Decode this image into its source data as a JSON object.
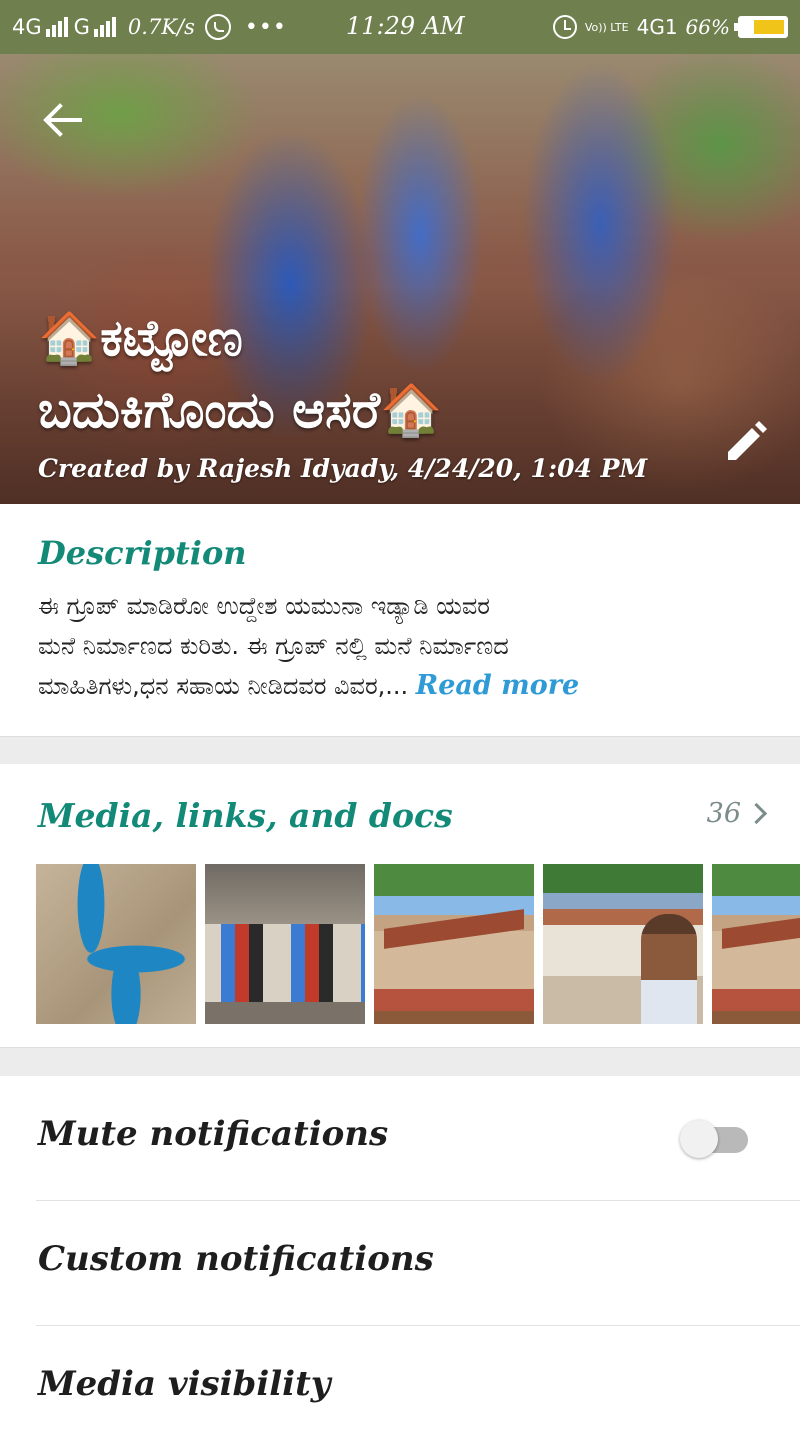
{
  "status_bar": {
    "network1": "4G",
    "network2": "G",
    "speed": "0.7K/s",
    "more": "•••",
    "time": "11:29 AM",
    "volte": "Vo)) LTE",
    "network3": "4G1",
    "battery_pct": "66%",
    "battery_level": 0.66,
    "icons": [
      "signal-bars-icon",
      "whatsapp-icon",
      "alarm-icon",
      "battery-icon"
    ]
  },
  "header": {
    "title_line1": "🏠ಕಟ್ಟೋಣ",
    "title_line2": "ಬದುಕಿಗೊಂದು ಆಸರೆ🏠",
    "created_by": "Created by Rajesh Idyady, 4/24/20, 1:04 PM",
    "back_icon": "back-arrow-icon",
    "edit_icon": "pencil-icon"
  },
  "description": {
    "heading": "Description",
    "text_line1": "ಈ ಗ್ರೂಪ್ ಮಾಡಿರೋ ಉದ್ದೇಶ ಯಮುನಾ ಇಡ್ಯಾಡಿ ಯವರ",
    "text_line2": "ಮನೆ ನಿರ್ಮಾಣದ ಕುರಿತು. ಈ ಗ್ರೂಪ್ ನಲ್ಲಿ ಮನೆ ನಿರ್ಮಾಣದ",
    "text_line3": "ಮಾಹಿತಿಗಳು,ಧನ ಸಹಾಯ ನೀಡಿದವರ ವಿವರ,...",
    "read_more": "Read more"
  },
  "media": {
    "heading": "Media, links, and docs",
    "count": "36",
    "thumbnails": [
      "fan-photo",
      "people-group-photo",
      "house-construction-photo",
      "man-selfie-house-photo",
      "house-construction-photo-2"
    ]
  },
  "settings": {
    "mute_label": "Mute notifications",
    "mute_on": false,
    "custom_label": "Custom notifications",
    "media_visibility_label": "Media visibility"
  },
  "colors": {
    "status_bar": "#6f7f4e",
    "accent_teal": "#138a78",
    "link_blue": "#2f9bd6"
  }
}
